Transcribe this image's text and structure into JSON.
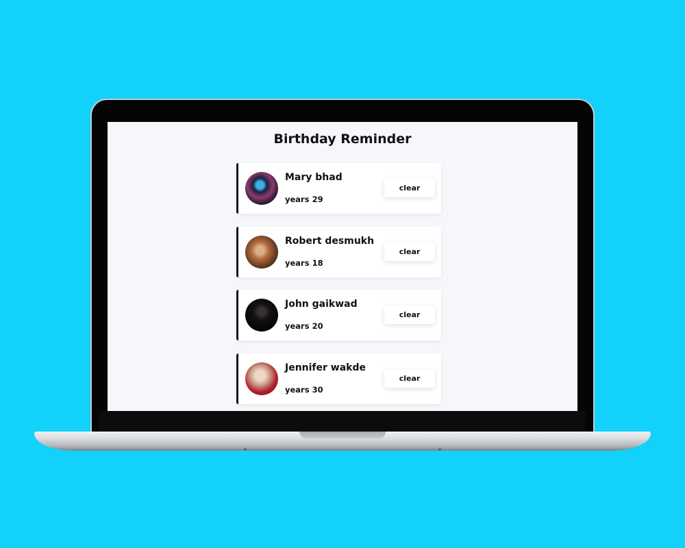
{
  "app": {
    "title": "Birthday Reminder",
    "clear_label": "clear"
  },
  "people": [
    {
      "name": "Mary bhad",
      "age": "years 29",
      "avatar_icon": "avatar-photo"
    },
    {
      "name": "Robert desmukh",
      "age": "years 18",
      "avatar_icon": "avatar-photo"
    },
    {
      "name": "John gaikwad",
      "age": "years 20",
      "avatar_icon": "avatar-photo"
    },
    {
      "name": "Jennifer wakde",
      "age": "years 30",
      "avatar_icon": "avatar-photo"
    }
  ],
  "colors": {
    "background": "#12d1fb",
    "screen": "#f6f7fb",
    "card": "#ffffff",
    "accent": "#111111"
  }
}
